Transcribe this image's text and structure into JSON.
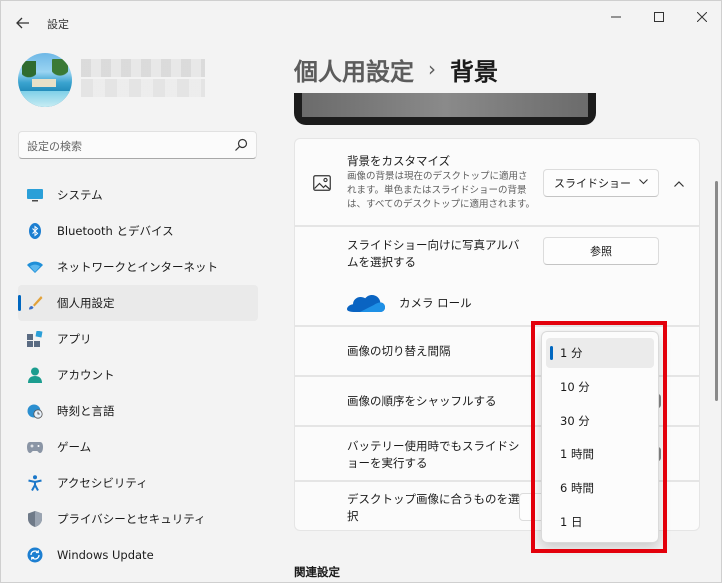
{
  "window": {
    "title": "設定",
    "controls": {
      "minimize": "─",
      "maximize": "☐",
      "close": "✕"
    }
  },
  "sidebar": {
    "search_placeholder": "設定の検索",
    "items": [
      {
        "label": "システム",
        "icon": "monitor-icon"
      },
      {
        "label": "Bluetooth とデバイス",
        "icon": "bluetooth-icon"
      },
      {
        "label": "ネットワークとインターネット",
        "icon": "wifi-icon"
      },
      {
        "label": "個人用設定",
        "icon": "brush-icon",
        "active": true
      },
      {
        "label": "アプリ",
        "icon": "apps-icon"
      },
      {
        "label": "アカウント",
        "icon": "person-icon"
      },
      {
        "label": "時刻と言語",
        "icon": "globe-clock-icon"
      },
      {
        "label": "ゲーム",
        "icon": "gamepad-icon"
      },
      {
        "label": "アクセシビリティ",
        "icon": "accessibility-icon"
      },
      {
        "label": "プライバシーとセキュリティ",
        "icon": "shield-icon"
      },
      {
        "label": "Windows Update",
        "icon": "update-icon"
      }
    ]
  },
  "breadcrumb": {
    "parent": "個人用設定",
    "separator": "›",
    "current": "背景"
  },
  "background_card": {
    "title": "背景をカスタマイズ",
    "description": "画像の背景は現在のデスクトップに適用されます。単色またはスライドショーの背景は、すべてのデスクトップに適用されます。",
    "selected_value": "スライドショー"
  },
  "album": {
    "label": "スライドショー向けに写真アルバムを選択する",
    "browse_label": "参照",
    "folder_name": "カメラ ロール"
  },
  "rows": {
    "interval_label": "画像の切り替え間隔",
    "shuffle_label": "画像の順序をシャッフルする",
    "battery_label": "バッテリー使用時でもスライドショーを実行する",
    "fit_label": "デスクトップ画像に合うものを選択"
  },
  "interval_dropdown": {
    "options": [
      "1 分",
      "10 分",
      "30 分",
      "1 時間",
      "6 時間",
      "1 日"
    ],
    "selected": "1 分"
  },
  "related": {
    "label": "関連設定"
  },
  "colors": {
    "accent": "#0067c0",
    "highlight_frame": "#e3000b"
  }
}
